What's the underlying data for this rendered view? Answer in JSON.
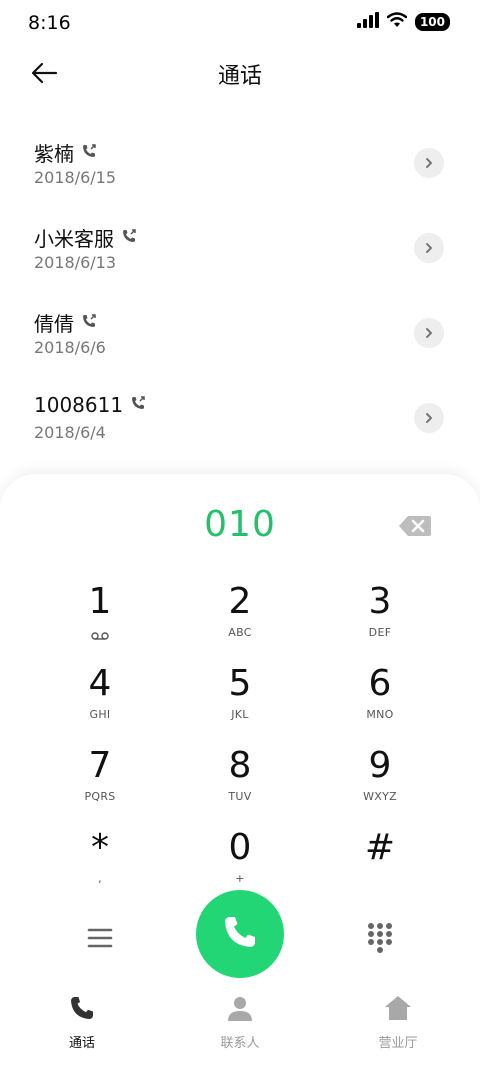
{
  "status_bar": {
    "time": "8:16",
    "battery": "100",
    "icons": [
      "signal-icon",
      "wifi-icon",
      "battery-icon"
    ]
  },
  "header": {
    "title": "通话",
    "back_icon": "arrow-left-icon"
  },
  "calls": [
    {
      "name": "紫楠",
      "date": "2018/6/15",
      "icon": "outgoing-call-icon"
    },
    {
      "name": "小米客服",
      "date": "2018/6/13",
      "icon": "outgoing-call-icon"
    },
    {
      "name": "倩倩",
      "date": "2018/6/6",
      "icon": "outgoing-call-icon"
    },
    {
      "name": "1008611",
      "date": "2018/6/4",
      "icon": "outgoing-call-icon"
    }
  ],
  "dialer": {
    "number": "010",
    "keys": [
      {
        "digit": "1",
        "letters": "",
        "sub_icon": "voicemail-icon"
      },
      {
        "digit": "2",
        "letters": "ABC"
      },
      {
        "digit": "3",
        "letters": "DEF"
      },
      {
        "digit": "4",
        "letters": "GHI"
      },
      {
        "digit": "5",
        "letters": "JKL"
      },
      {
        "digit": "6",
        "letters": "MNO"
      },
      {
        "digit": "7",
        "letters": "PQRS"
      },
      {
        "digit": "8",
        "letters": "TUV"
      },
      {
        "digit": "9",
        "letters": "WXYZ"
      },
      {
        "digit": "*",
        "letters": ","
      },
      {
        "digit": "0",
        "letters": "+"
      },
      {
        "digit": "#",
        "letters": ""
      }
    ],
    "accent_color": "#22d676",
    "number_color": "#22c26a"
  },
  "bottom_nav": [
    {
      "label": "通话",
      "icon": "phone-icon",
      "active": true
    },
    {
      "label": "联系人",
      "icon": "person-icon",
      "active": false
    },
    {
      "label": "营业厅",
      "icon": "home-icon",
      "active": false
    }
  ]
}
